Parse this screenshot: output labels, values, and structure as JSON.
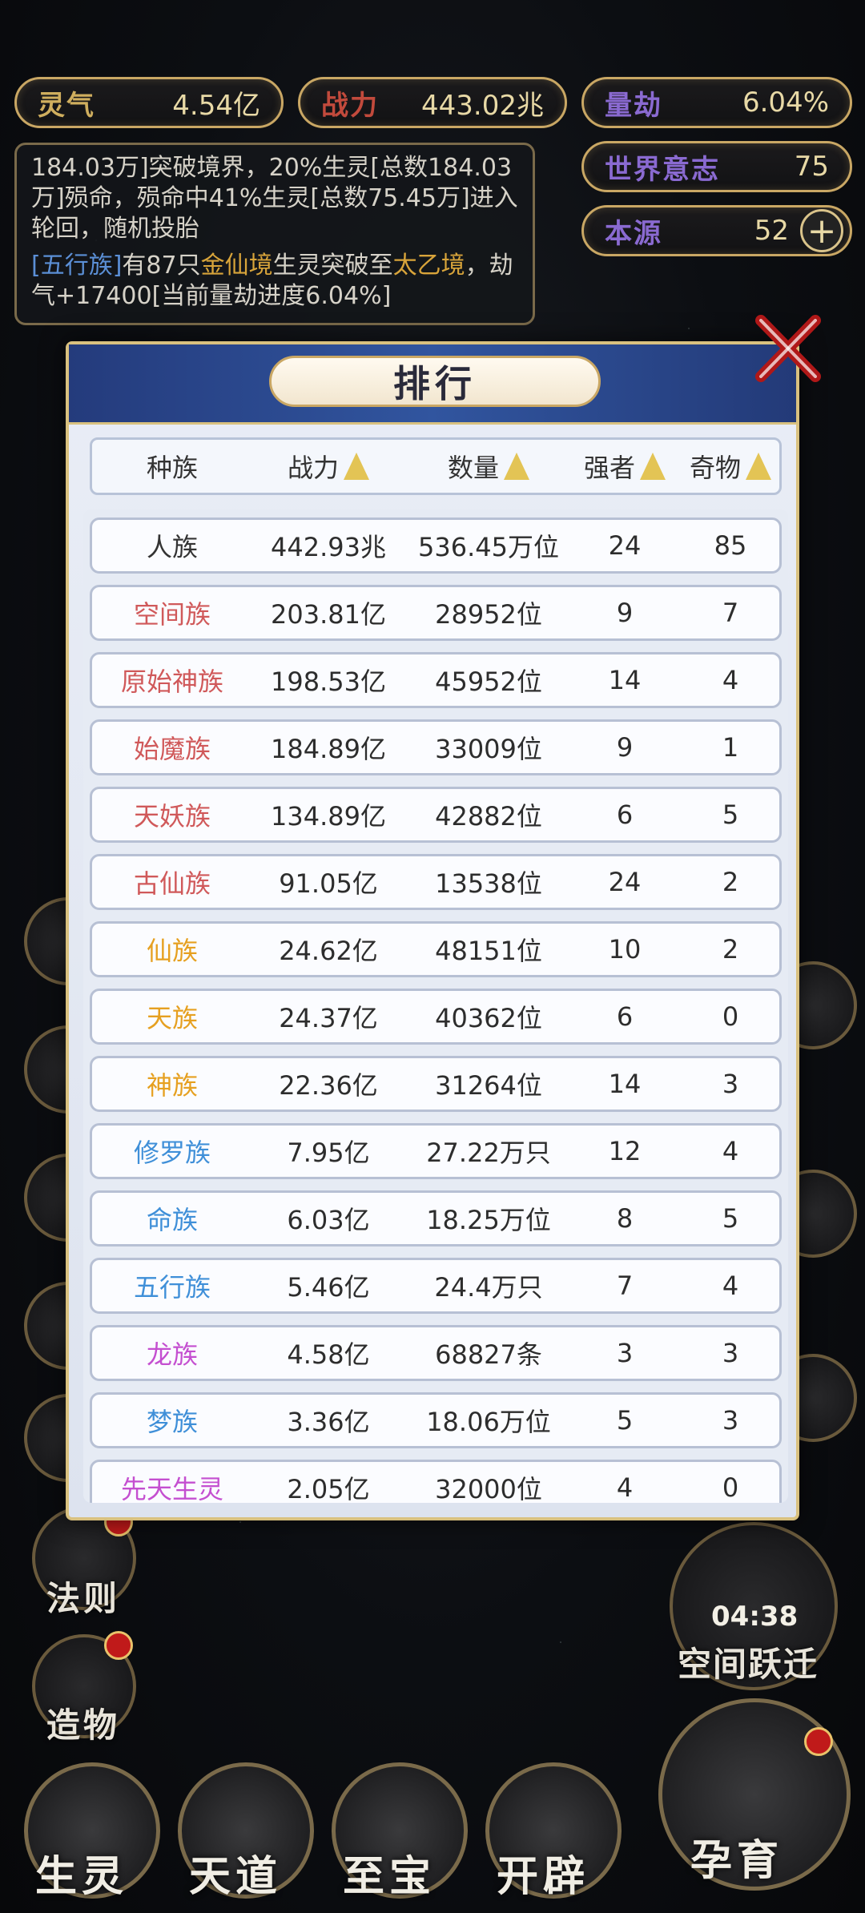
{
  "stats": {
    "lingqi_label": "灵气",
    "lingqi_value": "4.54亿",
    "zhanli_label": "战力",
    "zhanli_value": "443.02兆",
    "liangjie_label": "量劫",
    "liangjie_value": "6.04%",
    "yizhi_label": "世界意志",
    "yizhi_value": "75",
    "benyuan_label": "本源",
    "benyuan_value": "52"
  },
  "message": {
    "line1": "184.03万]突破境界，20%生灵[总数184.03万]殒命，殒命中41%生灵[总数75.45万]进入轮回，随机投胎",
    "line2_a": "[五行族]",
    "line2_b": "有87只",
    "line2_c": "金仙境",
    "line2_d": "生灵突破至",
    "line2_e": "太乙境",
    "line2_f": "，劫气+17400[当前量劫进度6.04%]"
  },
  "modal": {
    "title": "排行",
    "headers": [
      "种族",
      "战力",
      "数量",
      "强者",
      "奇物"
    ]
  },
  "rows": [
    {
      "name": "人族",
      "color": "#333333",
      "power": "442.93兆",
      "count": "536.45万位",
      "strong": "24",
      "items": "85"
    },
    {
      "name": "空间族",
      "color": "#d0595a",
      "power": "203.81亿",
      "count": "28952位",
      "strong": "9",
      "items": "7"
    },
    {
      "name": "原始神族",
      "color": "#d0595a",
      "power": "198.53亿",
      "count": "45952位",
      "strong": "14",
      "items": "4"
    },
    {
      "name": "始魔族",
      "color": "#d0595a",
      "power": "184.89亿",
      "count": "33009位",
      "strong": "9",
      "items": "1"
    },
    {
      "name": "天妖族",
      "color": "#d0595a",
      "power": "134.89亿",
      "count": "42882位",
      "strong": "6",
      "items": "5"
    },
    {
      "name": "古仙族",
      "color": "#d0595a",
      "power": "91.05亿",
      "count": "13538位",
      "strong": "24",
      "items": "2"
    },
    {
      "name": "仙族",
      "color": "#e6a020",
      "power": "24.62亿",
      "count": "48151位",
      "strong": "10",
      "items": "2"
    },
    {
      "name": "天族",
      "color": "#e6a020",
      "power": "24.37亿",
      "count": "40362位",
      "strong": "6",
      "items": "0"
    },
    {
      "name": "神族",
      "color": "#e6a020",
      "power": "22.36亿",
      "count": "31264位",
      "strong": "14",
      "items": "3"
    },
    {
      "name": "修罗族",
      "color": "#3f8fd8",
      "power": "7.95亿",
      "count": "27.22万只",
      "strong": "12",
      "items": "4"
    },
    {
      "name": "命族",
      "color": "#3f8fd8",
      "power": "6.03亿",
      "count": "18.25万位",
      "strong": "8",
      "items": "5"
    },
    {
      "name": "五行族",
      "color": "#3f8fd8",
      "power": "5.46亿",
      "count": "24.4万只",
      "strong": "7",
      "items": "4"
    },
    {
      "name": "龙族",
      "color": "#c44fd0",
      "power": "4.58亿",
      "count": "68827条",
      "strong": "3",
      "items": "3"
    },
    {
      "name": "梦族",
      "color": "#3f8fd8",
      "power": "3.36亿",
      "count": "18.06万位",
      "strong": "5",
      "items": "3"
    },
    {
      "name": "先天生灵",
      "color": "#c44fd0",
      "power": "2.05亿",
      "count": "32000位",
      "strong": "4",
      "items": "0"
    }
  ],
  "side": {
    "fa_ze": "法则",
    "zao_wu": "造物",
    "kong_jian": "空间跃迁",
    "timer": "04:38"
  },
  "tabs": [
    "生灵",
    "天道",
    "至宝",
    "开辟",
    "孕育"
  ]
}
